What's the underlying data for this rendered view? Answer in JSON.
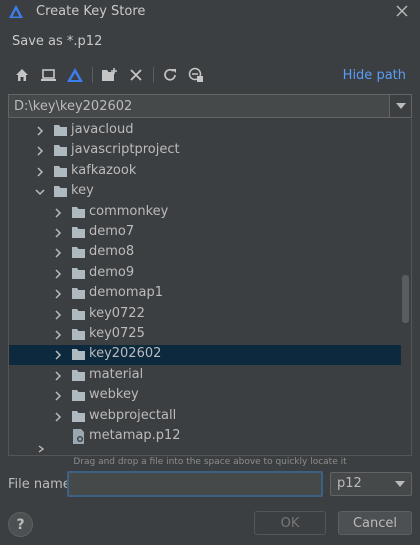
{
  "window": {
    "title": "Create Key Store",
    "subtitle": "Save as *.p12"
  },
  "toolbar": {
    "icons": [
      "home-icon",
      "desktop-icon",
      "project-icon",
      "new-folder-icon",
      "delete-icon",
      "refresh-icon",
      "show-hidden-icon"
    ],
    "hide_path_label": "Hide path"
  },
  "path": {
    "value": "D:\\key\\key202602"
  },
  "tree": {
    "items": [
      {
        "label": "javacloud",
        "type": "folder"
      },
      {
        "label": "javascriptproject",
        "type": "folder"
      },
      {
        "label": "kafkazook",
        "type": "folder"
      },
      {
        "label": "key",
        "type": "folder"
      },
      {
        "label": "commonkey",
        "type": "folder"
      },
      {
        "label": "demo7",
        "type": "folder"
      },
      {
        "label": "demo8",
        "type": "folder"
      },
      {
        "label": "demo9",
        "type": "folder"
      },
      {
        "label": "demomap1",
        "type": "folder"
      },
      {
        "label": "key0722",
        "type": "folder"
      },
      {
        "label": "key0725",
        "type": "folder"
      },
      {
        "label": "key202602",
        "type": "folder"
      },
      {
        "label": "material",
        "type": "folder"
      },
      {
        "label": "webkey",
        "type": "folder"
      },
      {
        "label": "webprojectall",
        "type": "folder"
      },
      {
        "label": "metamap.p12",
        "type": "file"
      }
    ],
    "hint": "Drag and drop a file into the space above to quickly locate it"
  },
  "footer": {
    "filename_label": "File name:",
    "filename_value": "",
    "filetype_value": "p12",
    "help_label": "?",
    "ok_label": "OK",
    "cancel_label": "Cancel"
  },
  "colors": {
    "background": "#3c3f41",
    "selection": "#0d293e",
    "link": "#589df6",
    "folder": "#aeb9c0",
    "focus_border": "#3d6185"
  }
}
